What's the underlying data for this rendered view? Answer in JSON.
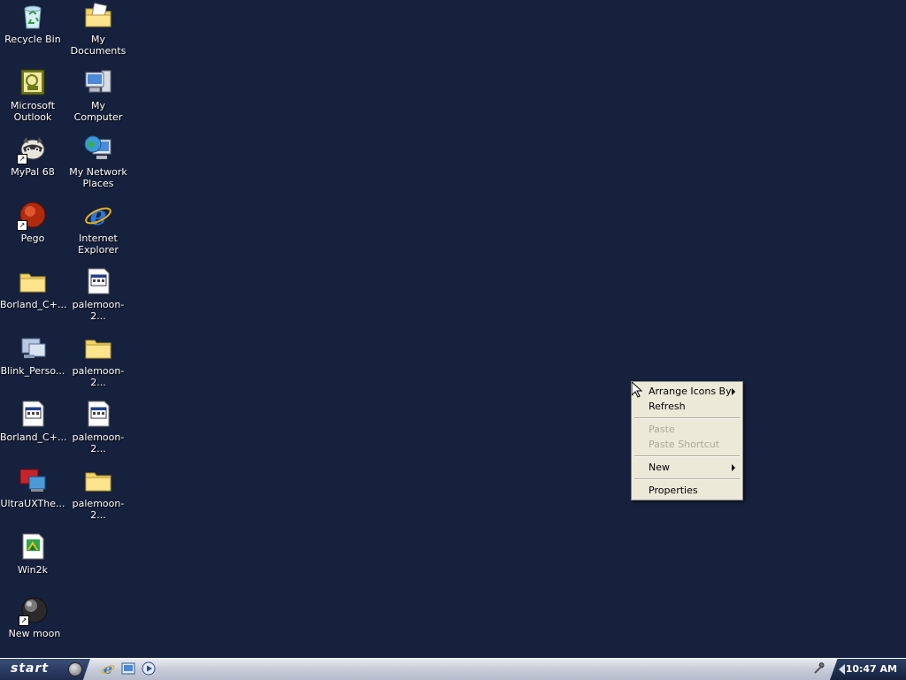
{
  "desktop": {
    "icons": [
      {
        "name": "recycle-bin",
        "label": "Recycle Bin",
        "icon": "recycle-bin-icon"
      },
      {
        "name": "my-documents",
        "label": "My Documents",
        "icon": "folder-documents-icon"
      },
      {
        "name": "microsoft-outlook",
        "label": "Microsoft\nOutlook",
        "icon": "outlook-icon"
      },
      {
        "name": "my-computer",
        "label": "My Computer",
        "icon": "computer-icon"
      },
      {
        "name": "mypal-68",
        "label": "MyPal 68",
        "icon": "mypal-icon"
      },
      {
        "name": "my-network-places",
        "label": "My Network\nPlaces",
        "icon": "network-icon"
      },
      {
        "name": "pego",
        "label": "Pego",
        "icon": "pego-icon"
      },
      {
        "name": "internet-explorer",
        "label": "Internet\nExplorer",
        "icon": "ie-icon"
      },
      {
        "name": "borland-folder",
        "label": "Borland_C+...",
        "icon": "folder-icon"
      },
      {
        "name": "palemoon-file-1",
        "label": "palemoon-2...",
        "icon": "exe-icon"
      },
      {
        "name": "blink-personal",
        "label": "Blink_Perso...",
        "icon": "blink-icon"
      },
      {
        "name": "palemoon-folder-1",
        "label": "palemoon-2...",
        "icon": "folder-icon"
      },
      {
        "name": "borland-file",
        "label": "Borland_C+...",
        "icon": "exe-icon"
      },
      {
        "name": "palemoon-file-2",
        "label": "palemoon-2...",
        "icon": "exe-icon"
      },
      {
        "name": "ultrauxtheme",
        "label": "UltraUXThe...",
        "icon": "ultraux-icon"
      },
      {
        "name": "palemoon-folder-2",
        "label": "palemoon-2...",
        "icon": "folder-icon"
      },
      {
        "name": "win2k",
        "label": "Win2k",
        "icon": "win2k-file-icon"
      },
      {
        "name": "new-moon",
        "label": "New moon",
        "icon": "moon-icon"
      }
    ]
  },
  "context_menu": {
    "arrange_icons_by": "Arrange Icons By",
    "refresh": "Refresh",
    "paste": "Paste",
    "paste_shortcut": "Paste Shortcut",
    "new": "New",
    "properties": "Properties"
  },
  "taskbar": {
    "start_label": "start",
    "quick_launch": [
      "ie-icon",
      "desktop-icon",
      "media-player-icon"
    ],
    "clock": "10:47 AM"
  },
  "colors": {
    "desktop_bg": "#16213d",
    "menu_bg": "#ece9d8",
    "disabled_text": "#aca899"
  }
}
